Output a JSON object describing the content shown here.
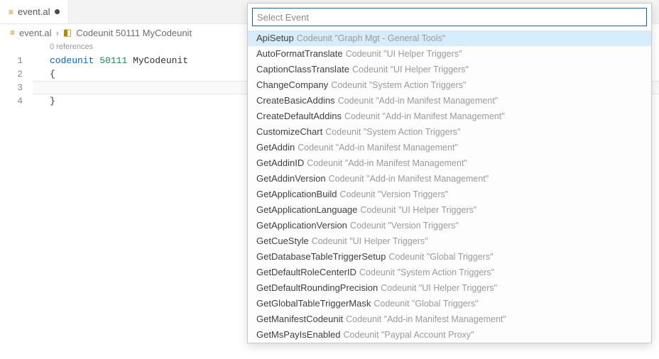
{
  "tab": {
    "filename": "event.al"
  },
  "breadcrumb": {
    "file": "event.al",
    "symbol": "Codeunit 50111 MyCodeunit"
  },
  "code": {
    "references_label": "0 references",
    "line_numbers": [
      "1",
      "2",
      "3",
      "4"
    ],
    "kw_codeunit": "codeunit",
    "obj_number": "50111",
    "obj_name": "MyCodeunit",
    "brace_open": "{",
    "brace_close": "}"
  },
  "picker": {
    "placeholder": "Select Event",
    "items": [
      {
        "event": "ApiSetup",
        "source": "Codeunit \"Graph Mgt - General Tools\""
      },
      {
        "event": "AutoFormatTranslate",
        "source": "Codeunit \"UI Helper Triggers\""
      },
      {
        "event": "CaptionClassTranslate",
        "source": "Codeunit \"UI Helper Triggers\""
      },
      {
        "event": "ChangeCompany",
        "source": "Codeunit \"System Action Triggers\""
      },
      {
        "event": "CreateBasicAddins",
        "source": "Codeunit \"Add-in Manifest Management\""
      },
      {
        "event": "CreateDefaultAddins",
        "source": "Codeunit \"Add-in Manifest Management\""
      },
      {
        "event": "CustomizeChart",
        "source": "Codeunit \"System Action Triggers\""
      },
      {
        "event": "GetAddin",
        "source": "Codeunit \"Add-in Manifest Management\""
      },
      {
        "event": "GetAddinID",
        "source": "Codeunit \"Add-in Manifest Management\""
      },
      {
        "event": "GetAddinVersion",
        "source": "Codeunit \"Add-in Manifest Management\""
      },
      {
        "event": "GetApplicationBuild",
        "source": "Codeunit \"Version Triggers\""
      },
      {
        "event": "GetApplicationLanguage",
        "source": "Codeunit \"UI Helper Triggers\""
      },
      {
        "event": "GetApplicationVersion",
        "source": "Codeunit \"Version Triggers\""
      },
      {
        "event": "GetCueStyle",
        "source": "Codeunit \"UI Helper Triggers\""
      },
      {
        "event": "GetDatabaseTableTriggerSetup",
        "source": "Codeunit \"Global Triggers\""
      },
      {
        "event": "GetDefaultRoleCenterID",
        "source": "Codeunit \"System Action Triggers\""
      },
      {
        "event": "GetDefaultRoundingPrecision",
        "source": "Codeunit \"UI Helper Triggers\""
      },
      {
        "event": "GetGlobalTableTriggerMask",
        "source": "Codeunit \"Global Triggers\""
      },
      {
        "event": "GetManifestCodeunit",
        "source": "Codeunit \"Add-in Manifest Management\""
      },
      {
        "event": "GetMsPayIsEnabled",
        "source": "Codeunit \"Paypal Account Proxy\""
      }
    ]
  }
}
